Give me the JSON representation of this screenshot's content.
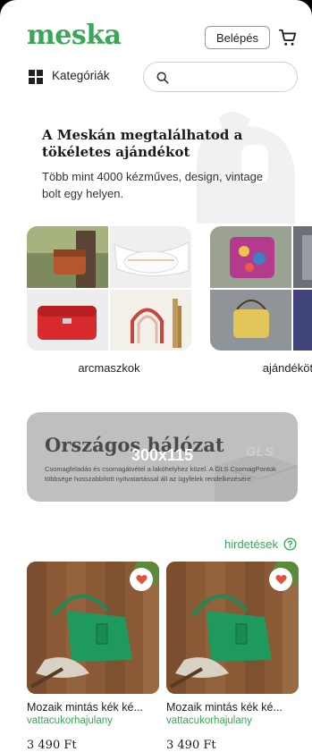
{
  "header": {
    "logo": "meska",
    "login_label": "Belépés"
  },
  "nav": {
    "categories_label": "Kategóriák",
    "search_placeholder": ""
  },
  "hero": {
    "title": "A Meskán megtalálhatod a tökéletes ajándékot",
    "subtitle": "Több mint 4000 kézműves, design, vintage bolt egy helyen."
  },
  "categories": [
    {
      "name": "arcmaszkok"
    },
    {
      "name": "ajándékötle"
    }
  ],
  "banner": {
    "title": "Országos hálózat",
    "size_label": "300x115",
    "text": "Csomagfeladás és csomagátvétel a lakóhelyhez közel. A GLS CsomagPontok többsége hosszabbított nyitvatartással áll az ügyfelek rendelkezésére.",
    "brand": "GLS"
  },
  "ads": {
    "label": "hirdetések"
  },
  "products": [
    {
      "title": "Mozaik mintás kék ké...",
      "seller": "vattacukorhajulany",
      "price": "3 490 Ft"
    },
    {
      "title": "Mozaik mintás kék ké...",
      "seller": "vattacukorhajulany",
      "price": "3 490 Ft"
    }
  ],
  "colors": {
    "brand_green": "#3aa657",
    "heart_red": "#e0523b"
  }
}
